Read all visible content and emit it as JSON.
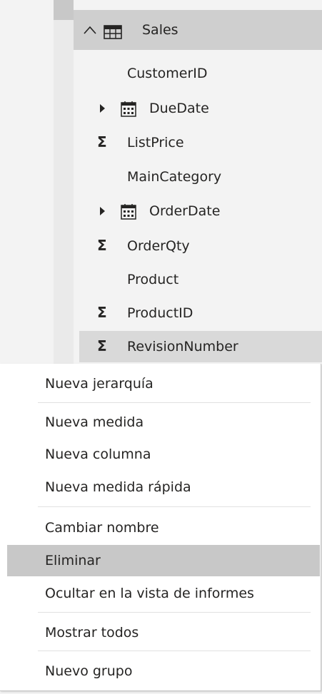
{
  "fields_pane": {
    "table": {
      "name": "Sales",
      "expanded": true,
      "icon": "table-icon"
    },
    "fields": [
      {
        "label": "CustomerID",
        "kind": "text"
      },
      {
        "label": "DueDate",
        "kind": "date"
      },
      {
        "label": "ListPrice",
        "kind": "sum"
      },
      {
        "label": "MainCategory",
        "kind": "text"
      },
      {
        "label": "OrderDate",
        "kind": "date"
      },
      {
        "label": "OrderQty",
        "kind": "sum"
      },
      {
        "label": "Product",
        "kind": "text"
      },
      {
        "label": "ProductID",
        "kind": "sum"
      },
      {
        "label": "RevisionNumber",
        "kind": "sum",
        "selected": true
      }
    ],
    "sum_glyph": "Σ"
  },
  "context_menu": {
    "items": [
      {
        "label": "Nueva jerarquía"
      },
      {
        "label": "Nueva medida"
      },
      {
        "label": "Nueva columna"
      },
      {
        "label": "Nueva medida rápida"
      },
      {
        "label": "Cambiar nombre"
      },
      {
        "label": "Eliminar",
        "highlighted": true
      },
      {
        "label": "Ocultar en la vista de informes"
      },
      {
        "label": "Mostrar todos"
      },
      {
        "label": "Nuevo grupo"
      }
    ]
  },
  "colors": {
    "pane_bg": "#f3f3f3",
    "header_bg": "#cfcfcf",
    "selected_bg": "#d9d9d9",
    "menu_bg": "#ffffff",
    "menu_hover": "#c8c8c8",
    "text": "#252423"
  }
}
